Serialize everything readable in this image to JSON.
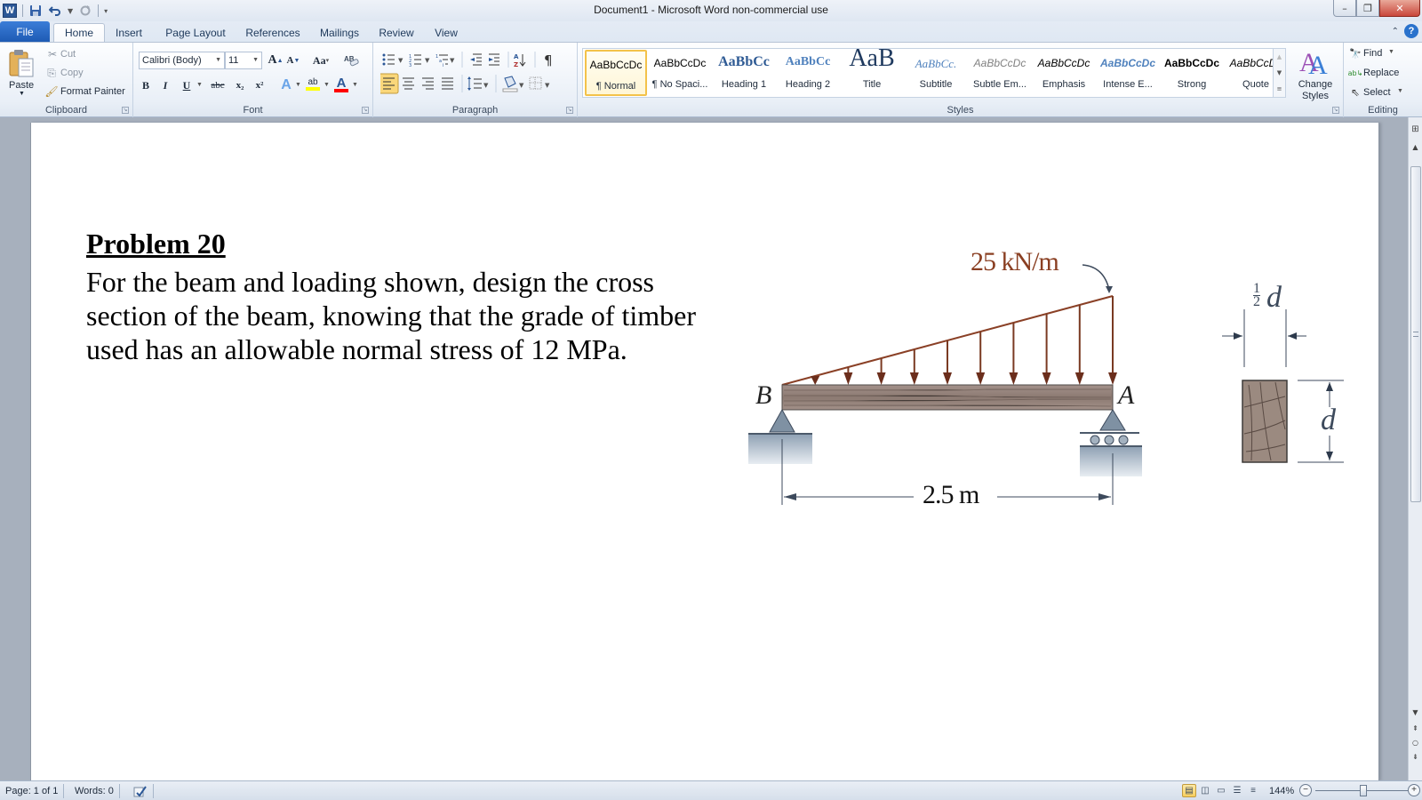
{
  "window": {
    "title": "Document1  -  Microsoft Word non-commercial use",
    "app_icon": "W",
    "controls": {
      "minimize": "–",
      "restore": "❐",
      "close": "✕"
    }
  },
  "quick_access": {
    "save_icon": "💾",
    "undo_icon": "↶",
    "redo_icon": "↻",
    "customize_icon": "▾"
  },
  "tabs": {
    "file": "File",
    "items": [
      "Home",
      "Insert",
      "Page Layout",
      "References",
      "Mailings",
      "Review",
      "View"
    ],
    "active": "Home",
    "help": "?",
    "minimize_ribbon": "⌃"
  },
  "ribbon": {
    "clipboard": {
      "label": "Clipboard",
      "paste": "Paste",
      "cut": "Cut",
      "copy": "Copy",
      "format_painter": "Format Painter"
    },
    "font": {
      "label": "Font",
      "font_name": "Calibri (Body)",
      "font_size": "11",
      "grow": "A",
      "shrink": "A",
      "change_case": "Aa",
      "clear_formatting": "A",
      "bold": "B",
      "italic": "I",
      "underline": "U",
      "strikethrough": "abc",
      "subscript": "x₂",
      "superscript": "x²",
      "text_effects": "A",
      "highlight": "ab",
      "font_color": "A",
      "highlight_color": "#ffff00",
      "font_color_value": "#ff0000"
    },
    "paragraph": {
      "label": "Paragraph",
      "show_marks": "¶",
      "sort": "A↓"
    },
    "styles": {
      "label": "Styles",
      "items": [
        {
          "sample": "AaBbCcDc",
          "name": "¶ Normal",
          "active": true
        },
        {
          "sample": "AaBbCcDc",
          "name": "¶ No Spaci..."
        },
        {
          "sample": "AaBbCc",
          "name": "Heading 1"
        },
        {
          "sample": "AaBbCc",
          "name": "Heading 2"
        },
        {
          "sample": "AaB",
          "name": "Title"
        },
        {
          "sample": "AaBbCc.",
          "name": "Subtitle"
        },
        {
          "sample": "AaBbCcDc",
          "name": "Subtle Em..."
        },
        {
          "sample": "AaBbCcDc",
          "name": "Emphasis"
        },
        {
          "sample": "AaBbCcDc",
          "name": "Intense E..."
        },
        {
          "sample": "AaBbCcDc",
          "name": "Strong"
        },
        {
          "sample": "AaBbCcDc",
          "name": "Quote"
        }
      ],
      "change_styles": "Change Styles"
    },
    "editing": {
      "label": "Editing",
      "find": "Find",
      "replace": "Replace",
      "select": "Select"
    }
  },
  "document": {
    "title": "Problem 20",
    "body": "For the beam and loading shown, design the cross section of the beam, knowing that the grade of timber used has an allowable normal stress of 12 MPa.",
    "figure": {
      "load_label": "25 kN/m",
      "support_left": "B",
      "support_right": "A",
      "span_label": "2.5 m",
      "width_label_num": "1",
      "width_label_den": "2",
      "width_label_var": "d",
      "depth_label": "d",
      "load_color": "#7a3a22",
      "wood_color": "#9c8a80"
    }
  },
  "status": {
    "page": "Page: 1 of 1",
    "words": "Words: 0",
    "zoom": "144%",
    "zoom_out": "−",
    "zoom_in": "+"
  }
}
